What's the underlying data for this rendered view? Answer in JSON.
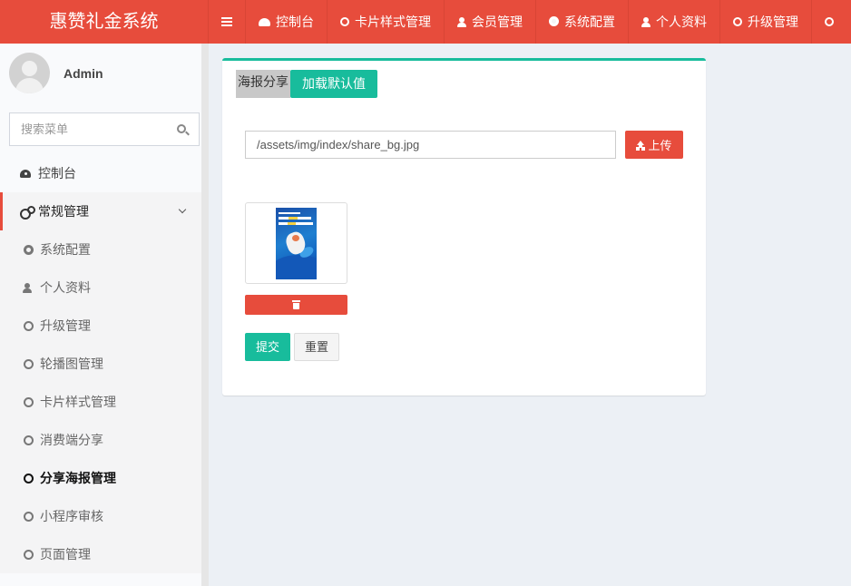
{
  "brand": {
    "title": "惠赞礼金系统"
  },
  "topnav": {
    "items": [
      {
        "label": "",
        "icon": "menu-toggle-icon"
      },
      {
        "label": "控制台",
        "icon": "dashboard-icon"
      },
      {
        "label": "卡片样式管理",
        "icon": "circle-icon"
      },
      {
        "label": "会员管理",
        "icon": "user-icon"
      },
      {
        "label": "系统配置",
        "icon": "gear-icon"
      },
      {
        "label": "个人资料",
        "icon": "user-icon"
      },
      {
        "label": "升级管理",
        "icon": "circle-icon"
      },
      {
        "label": "",
        "icon": "circle-icon"
      }
    ]
  },
  "user": {
    "name": "Admin"
  },
  "sidebar": {
    "search_placeholder": "搜索菜单",
    "dashboard": "控制台",
    "general": "常规管理",
    "sub_items": [
      {
        "label": "系统配置",
        "icon": "gear-icon"
      },
      {
        "label": "个人资料",
        "icon": "user-icon"
      },
      {
        "label": "升级管理",
        "icon": "circle-icon"
      },
      {
        "label": "轮播图管理",
        "icon": "circle-icon"
      },
      {
        "label": "卡片样式管理",
        "icon": "circle-icon"
      },
      {
        "label": "消费端分享",
        "icon": "circle-icon"
      },
      {
        "label": "分享海报管理",
        "icon": "circle-icon",
        "current": true
      },
      {
        "label": "小程序审核",
        "icon": "circle-icon"
      },
      {
        "label": "页面管理",
        "icon": "circle-icon"
      }
    ]
  },
  "main": {
    "tab_label": "海报分享",
    "load_default_label": "加载默认值",
    "image_path": "/assets/img/index/share_bg.jpg",
    "upload_label": "上传",
    "submit_label": "提交",
    "reset_label": "重置"
  },
  "colors": {
    "primary_red": "#e74c3c",
    "accent_green": "#18bc9c"
  }
}
